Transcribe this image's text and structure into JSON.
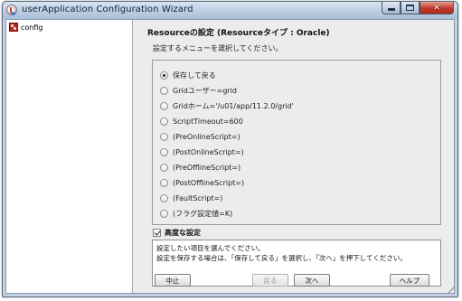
{
  "window": {
    "title": "userApplication Configuration Wizard",
    "icon": "java-app-icon"
  },
  "caption_buttons": {
    "minimize": "minimize-icon",
    "maximize": "maximize-icon",
    "close": "close-icon"
  },
  "tree": {
    "items": [
      {
        "label": "config",
        "icon": "config-node-icon"
      }
    ]
  },
  "main": {
    "heading": "Resourceの設定 (Resourceタイプ : Oracle)",
    "subheading": "設定するメニューを選択してください。",
    "options": [
      {
        "label": "保存して戻る",
        "checked": true
      },
      {
        "label": "Gridユーザー=grid",
        "checked": false
      },
      {
        "label": "Gridホーム='/u01/app/11.2.0/grid'",
        "checked": false
      },
      {
        "label": "ScriptTimeout=600",
        "checked": false
      },
      {
        "label": "(PreOnlineScript=)",
        "checked": false
      },
      {
        "label": "(PostOnlineScript=)",
        "checked": false
      },
      {
        "label": "(PreOfflineScript=)",
        "checked": false
      },
      {
        "label": "(PostOfflineScript=)",
        "checked": false
      },
      {
        "label": "(FaultScript=)",
        "checked": false
      },
      {
        "label": "(フラグ設定値=K)",
        "checked": false
      }
    ],
    "advanced": {
      "label": "高度な設定",
      "checked": true
    },
    "help": {
      "line1": "設定したい項目を選んでください。",
      "line2": "設定を保存する場合は、「保存して戻る」を選択し、「次へ」を押下してください。"
    }
  },
  "buttons": {
    "abort": {
      "label": "中止",
      "enabled": true
    },
    "back": {
      "label": "戻る",
      "enabled": false
    },
    "next": {
      "label": "次へ",
      "enabled": true
    },
    "help": {
      "label": "ヘルプ",
      "enabled": true
    }
  }
}
